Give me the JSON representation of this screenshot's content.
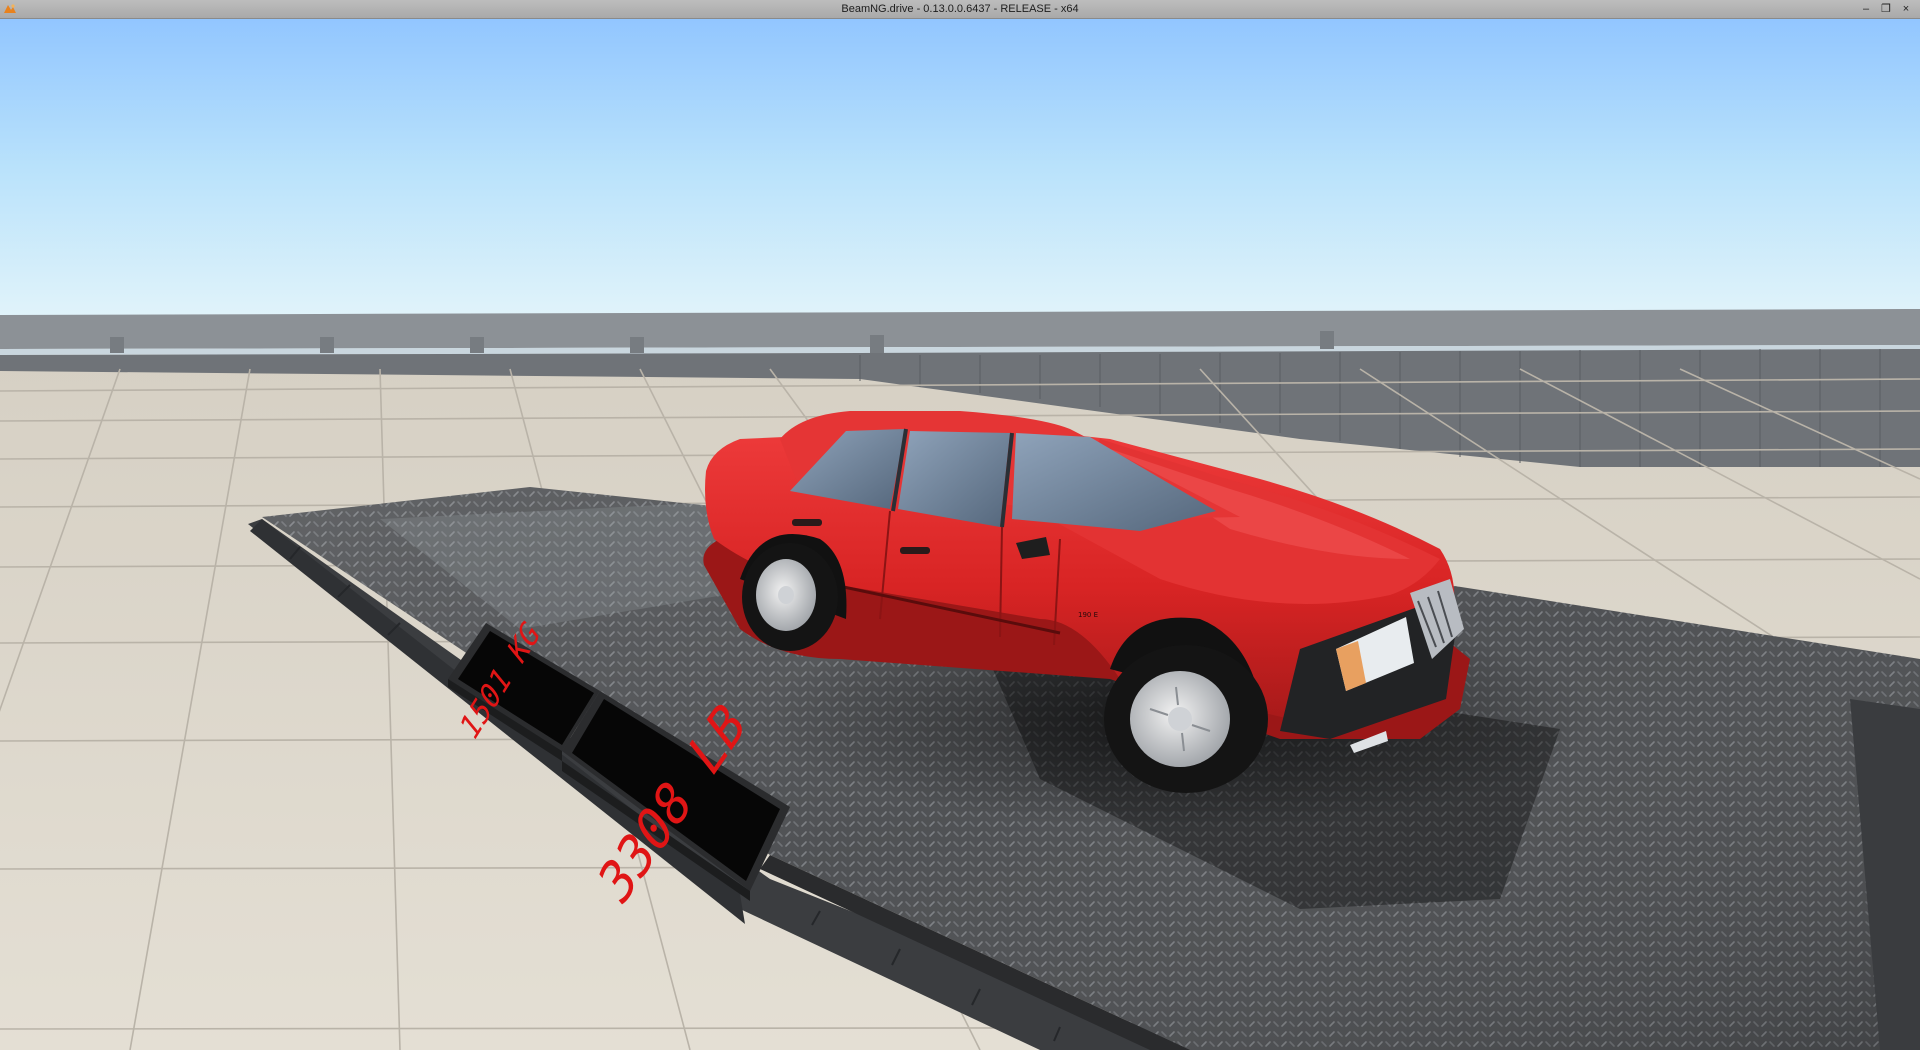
{
  "window": {
    "title": "BeamNG.drive - 0.13.0.0.6437 - RELEASE - x64",
    "icon": "beamng-logo-icon",
    "controls": {
      "minimize": "–",
      "restore": "❐",
      "close": "×"
    }
  },
  "scene": {
    "scale_display": {
      "kg": "1501 KG",
      "lb": "3308 LB"
    },
    "vehicle": {
      "color": "#e02a2a",
      "badge": "190 E"
    }
  },
  "colors": {
    "sky_top": "#9ccbff",
    "sky_horizon": "#e6f6fb",
    "floor": "#d8d2c6",
    "plate": "#4d4f52",
    "lcd_text": "#e01010"
  }
}
